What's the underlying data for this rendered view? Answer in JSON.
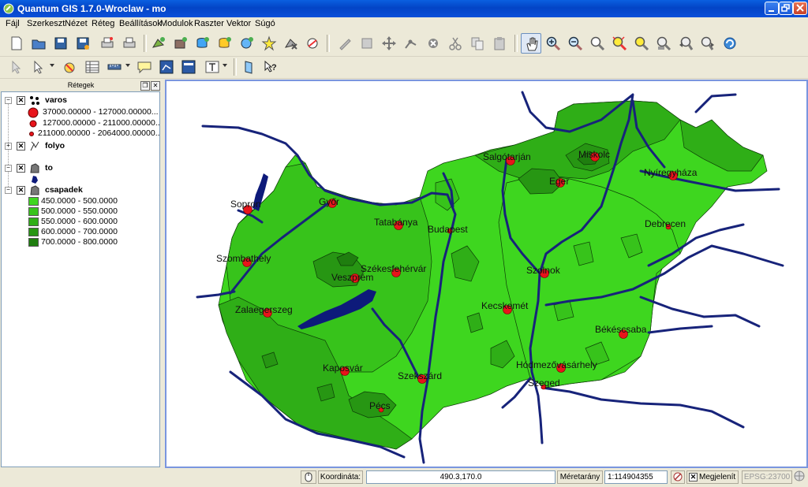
{
  "window": {
    "title": "Quantum GIS 1.7.0-Wroclaw - mo"
  },
  "menu": [
    "Fájl",
    "Szerkeszt",
    "Nézet",
    "Réteg",
    "Beállítások",
    "Modulok",
    "Raszter",
    "Vektor",
    "Súgó"
  ],
  "layers_panel": {
    "title": "Rétegek",
    "layers": [
      {
        "name": "varos",
        "classes": [
          "37000.00000 - 127000.00000...",
          "127000.00000 - 211000.00000...",
          "211000.00000 - 2064000.00000..."
        ]
      },
      {
        "name": "folyo"
      },
      {
        "name": "to"
      },
      {
        "name": "csapadek",
        "classes": [
          "450.0000 - 500.0000",
          "500.0000 - 550.0000",
          "550.0000 - 600.0000",
          "600.0000 - 700.0000",
          "700.0000 - 800.0000"
        ]
      }
    ],
    "class_colors": [
      "#3ed61f",
      "#37c31b",
      "#2fae17",
      "#279613",
      "#1f7e0f"
    ]
  },
  "map": {
    "cities": [
      "Sopron",
      "Győr",
      "Tatabánya",
      "Budapest",
      "Salgótarján",
      "Miskolc",
      "Eger",
      "Nyíregyháza",
      "Debrecen",
      "Szombathely",
      "Veszprém",
      "Székesfehérvár",
      "Szolnok",
      "Zalaegerszeg",
      "Kecskemét",
      "Békéscsaba",
      "Kaposvár",
      "Szekszárd",
      "Hódmezővásárhely",
      "Szeged",
      "Pécs"
    ],
    "colors": {
      "city": "#e8141b",
      "river": "#17237a",
      "lake": "#0d1a7a"
    }
  },
  "status": {
    "coord_label": "Koordináta:",
    "coord_value": "490.3,170.0",
    "scale_label": "Méretarány",
    "scale_value": "1:114904355",
    "render_label": "Megjelenít",
    "crs": "EPSG:23700"
  }
}
